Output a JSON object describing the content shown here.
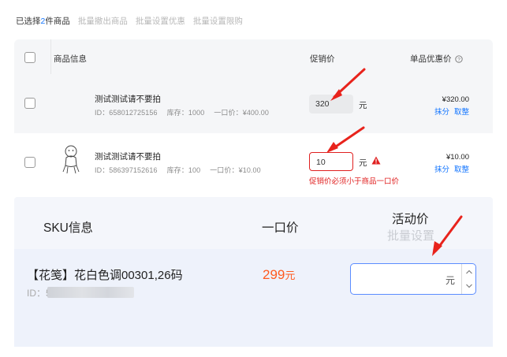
{
  "toolbar": {
    "selected_prefix": "已选择",
    "selected_count": "2",
    "selected_suffix": "件商品",
    "actions": [
      "批量撤出商品",
      "批量设置优惠",
      "批量设置限购"
    ]
  },
  "table": {
    "headers": {
      "product_info": "商品信息",
      "promo_price": "促销价",
      "unit_discount": "单品优惠价"
    },
    "rows": [
      {
        "title": "测试测试请不要拍",
        "id": "ID：658012725156",
        "stock": "库存：1000",
        "fixed_price": "一口价：¥400.00",
        "promo_value": "320",
        "unit": "元",
        "discount_price": "¥320.00",
        "link_round": "抹分",
        "link_integer": "取整"
      },
      {
        "title": "测试测试请不要拍",
        "id": "ID：586397152616",
        "stock": "库存：100",
        "fixed_price": "一口价：¥10.00",
        "promo_value": "10",
        "unit": "元",
        "discount_price": "¥10.00",
        "link_round": "抹分",
        "link_integer": "取整",
        "error": "促销价必须小于商品一口价"
      }
    ]
  },
  "sku": {
    "header_info": "SKU信息",
    "header_price": "一口价",
    "header_activity": "活动价",
    "batch_set": "批量设置",
    "item_name": "【花笺】花白色调00301,26码",
    "item_id_prefix": "ID：5",
    "item_price": "299",
    "item_price_unit": "元",
    "input_unit": "元"
  },
  "colors": {
    "accent_blue": "#1677ff",
    "error_red": "#e02020",
    "price_orange": "#ff5a1f",
    "annotation_arrow": "#e8231c"
  }
}
